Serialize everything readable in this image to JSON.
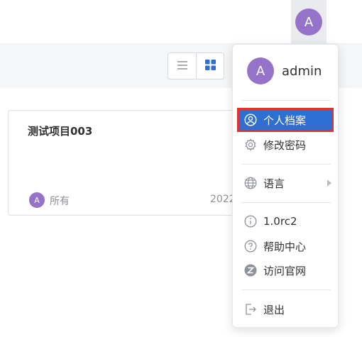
{
  "header": {
    "avatar_initial": "A"
  },
  "toolbar": {
    "view_toggle": [
      "list-icon",
      "grid-icon"
    ],
    "active_view": "grid"
  },
  "project_card": {
    "title": "测试项目003",
    "owner_initial": "A",
    "owner_label": "所有",
    "date": "2022"
  },
  "user_menu": {
    "avatar_initial": "A",
    "username": "admin",
    "items": [
      {
        "icon": "user-circle-icon",
        "label": "个人档案",
        "active": true
      },
      {
        "icon": "gear-icon",
        "label": "修改密码"
      },
      {
        "icon": "globe-icon",
        "label": "语言",
        "submenu": true
      },
      {
        "icon": "info-icon",
        "label": "1.0rc2"
      },
      {
        "icon": "help-icon",
        "label": "帮助中心"
      },
      {
        "icon": "website-icon",
        "label": "访问官网"
      },
      {
        "icon": "logout-icon",
        "label": "退出"
      }
    ]
  },
  "colors": {
    "accent": "#2d6fd3",
    "avatar": "#9573c9",
    "highlight_border": "#e03232"
  }
}
